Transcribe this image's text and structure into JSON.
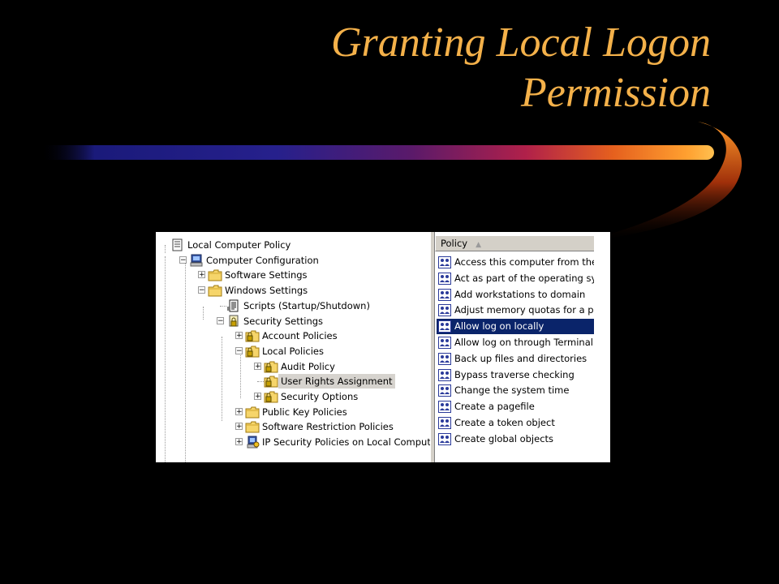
{
  "slide": {
    "title_line1": "Granting Local Logon",
    "title_line2": "Permission"
  },
  "tree": {
    "items": [
      {
        "label": "Local Computer Policy",
        "icon": "policy-doc-icon",
        "expander": "",
        "selected": false
      },
      {
        "label": "Computer Configuration",
        "icon": "computer-icon",
        "expander": "−",
        "selected": false
      },
      {
        "label": "Software Settings",
        "icon": "folder-icon",
        "expander": "+",
        "selected": false
      },
      {
        "label": "Windows Settings",
        "icon": "folder-icon",
        "expander": "−",
        "selected": false
      },
      {
        "label": "Scripts (Startup/Shutdown)",
        "icon": "script-icon",
        "expander": "",
        "selected": false
      },
      {
        "label": "Security Settings",
        "icon": "security-settings-icon",
        "expander": "−",
        "selected": false
      },
      {
        "label": "Account Policies",
        "icon": "locked-folder-icon",
        "expander": "+",
        "selected": false
      },
      {
        "label": "Local Policies",
        "icon": "locked-folder-icon",
        "expander": "−",
        "selected": false
      },
      {
        "label": "Audit Policy",
        "icon": "locked-folder-icon",
        "expander": "+",
        "selected": false
      },
      {
        "label": "User Rights Assignment",
        "icon": "locked-folder-icon",
        "expander": "",
        "selected": true
      },
      {
        "label": "Security Options",
        "icon": "locked-folder-icon",
        "expander": "+",
        "selected": false
      },
      {
        "label": "Public Key Policies",
        "icon": "folder-icon",
        "expander": "+",
        "selected": false
      },
      {
        "label": "Software Restriction Policies",
        "icon": "folder-icon",
        "expander": "+",
        "selected": false
      },
      {
        "label": "IP Security Policies on Local Computer",
        "icon": "ip-security-icon",
        "expander": "+",
        "selected": false
      }
    ]
  },
  "policy_list": {
    "column_header": "Policy",
    "sort_indicator": "▲",
    "items": [
      {
        "label": "Access this computer from the",
        "selected": false
      },
      {
        "label": "Act as part of the operating sy",
        "selected": false
      },
      {
        "label": "Add workstations to domain",
        "selected": false
      },
      {
        "label": "Adjust memory quotas for a p",
        "selected": false
      },
      {
        "label": "Allow log on locally",
        "selected": true
      },
      {
        "label": "Allow log on through Terminal",
        "selected": false
      },
      {
        "label": "Back up files and directories",
        "selected": false
      },
      {
        "label": "Bypass traverse checking",
        "selected": false
      },
      {
        "label": "Change the system time",
        "selected": false
      },
      {
        "label": "Create a pagefile",
        "selected": false
      },
      {
        "label": "Create a token object",
        "selected": false
      },
      {
        "label": "Create global objects",
        "selected": false
      }
    ]
  },
  "colors": {
    "title": "#f4b14a",
    "selection": "#0a246a",
    "tree_selection": "#d6d3ce"
  }
}
